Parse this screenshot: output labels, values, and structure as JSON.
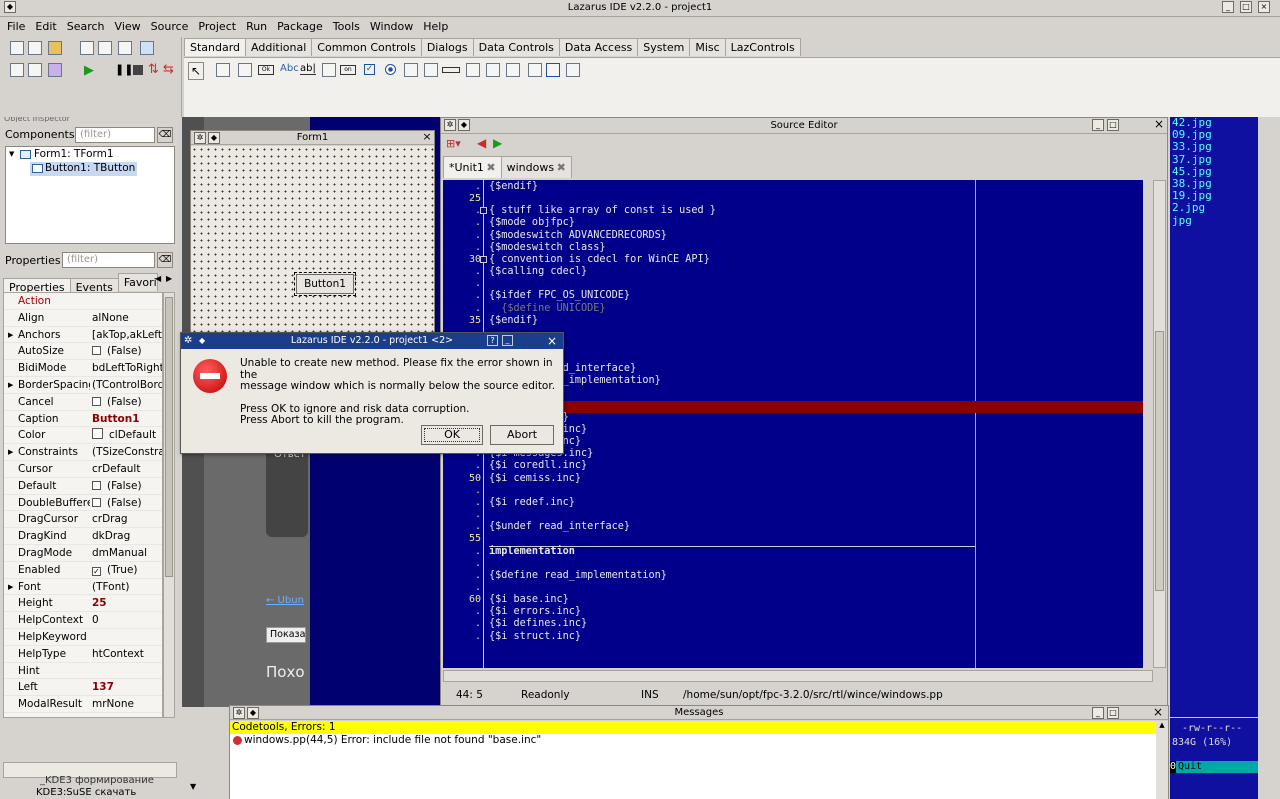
{
  "app": {
    "title": "Lazarus IDE v2.2.0 - project1"
  },
  "menu": [
    "File",
    "Edit",
    "Search",
    "View",
    "Source",
    "Project",
    "Run",
    "Package",
    "Tools",
    "Window",
    "Help"
  ],
  "palette_tabs": [
    "Standard",
    "Additional",
    "Common Controls",
    "Dialogs",
    "Data Controls",
    "Data Access",
    "System",
    "Misc",
    "LazControls"
  ],
  "palette_active": "Standard",
  "components": {
    "label": "Components",
    "filter_placeholder": "(filter)",
    "tree": [
      "Form1: TForm1",
      "Button1: TButton"
    ],
    "clipped_title": "Object Inspector"
  },
  "properties": {
    "label": "Properties",
    "filter_placeholder": "(filter)",
    "tabs": [
      "Properties",
      "Events",
      "Favorite"
    ],
    "rows": [
      {
        "name": "Action",
        "value": "",
        "red": true
      },
      {
        "name": "Align",
        "value": "alNone"
      },
      {
        "name": "Anchors",
        "value": "[akTop,akLeft]",
        "exp": true
      },
      {
        "name": "AutoSize",
        "value": "(False)",
        "cb": "unchecked"
      },
      {
        "name": "BidiMode",
        "value": "bdLeftToRight"
      },
      {
        "name": "BorderSpacing",
        "value": "(TControlBorde",
        "exp": true
      },
      {
        "name": "Cancel",
        "value": "(False)",
        "cb": "unchecked"
      },
      {
        "name": "Caption",
        "value": "Button1",
        "bold": true
      },
      {
        "name": "Color",
        "value": "clDefault",
        "swatch": true
      },
      {
        "name": "Constraints",
        "value": "(TSizeConstra",
        "exp": true
      },
      {
        "name": "Cursor",
        "value": "crDefault"
      },
      {
        "name": "Default",
        "value": "(False)",
        "cb": "unchecked"
      },
      {
        "name": "DoubleBuffered",
        "value": "(False)",
        "cb": "unchecked"
      },
      {
        "name": "DragCursor",
        "value": "crDrag"
      },
      {
        "name": "DragKind",
        "value": "dkDrag"
      },
      {
        "name": "DragMode",
        "value": "dmManual"
      },
      {
        "name": "Enabled",
        "value": "(True)",
        "cb": "checked"
      },
      {
        "name": "Font",
        "value": "(TFont)",
        "exp": true
      },
      {
        "name": "Height",
        "value": "25",
        "bold": true
      },
      {
        "name": "HelpContext",
        "value": "0"
      },
      {
        "name": "HelpKeyword",
        "value": ""
      },
      {
        "name": "HelpType",
        "value": "htContext"
      },
      {
        "name": "Hint",
        "value": ""
      },
      {
        "name": "Left",
        "value": "137",
        "bold": true
      },
      {
        "name": "ModalResult",
        "value": "mrNone"
      }
    ]
  },
  "form1": {
    "title": "Form1",
    "button": "Button1"
  },
  "background_page": {
    "link": "← Ubun",
    "button": "Показа",
    "heading": "Похо",
    "text": "Ответ"
  },
  "source_editor": {
    "title": "Source Editor",
    "tabs": [
      "*Unit1",
      "windows"
    ],
    "lines": [
      {
        "g": ".",
        "t": "{$endif}"
      },
      {
        "g": "25",
        "t": ""
      },
      {
        "g": ".",
        "t": "{ stuff like array of const is used }",
        "fold": true
      },
      {
        "g": ".",
        "t": "{$mode objfpc}"
      },
      {
        "g": ".",
        "t": "{$modeswitch ADVANCEDRECORDS}"
      },
      {
        "g": ".",
        "t": "{$modeswitch class}"
      },
      {
        "g": "30",
        "t": "{ convention is cdecl for WinCE API}",
        "fold": true
      },
      {
        "g": ".",
        "t": "{$calling cdecl}"
      },
      {
        "g": ".",
        "t": ""
      },
      {
        "g": ".",
        "t": "{$ifdef FPC_OS_UNICODE}"
      },
      {
        "g": ".",
        "t": "  {$define UNICODE}",
        "dim": true
      },
      {
        "g": "35",
        "t": "{$endif}"
      },
      {
        "g": ".",
        "t": ""
      },
      {
        "g": ".",
        "t": ""
      },
      {
        "g": ".",
        "t": ""
      },
      {
        "g": ".",
        "t": "{$define read_interface}"
      },
      {
        "g": ".",
        "t": "{$undef read_implementation}"
      },
      {
        "g": ".",
        "t": ""
      },
      {
        "g": ".",
        "t": "",
        "hl": true
      },
      {
        "g": ".",
        "t": "{$i base.inc}"
      },
      {
        "g": ".",
        "t": "{$i defines.inc}"
      },
      {
        "g": ".",
        "t": "{$i struct.inc}"
      },
      {
        "g": ".",
        "t": "{$i messages.inc}"
      },
      {
        "g": ".",
        "t": "{$i coredll.inc}"
      },
      {
        "g": "50",
        "t": "{$i cemiss.inc}"
      },
      {
        "g": ".",
        "t": ""
      },
      {
        "g": ".",
        "t": "{$i redef.inc}"
      },
      {
        "g": ".",
        "t": ""
      },
      {
        "g": ".",
        "t": "{$undef read_interface}"
      },
      {
        "g": "55",
        "t": ""
      },
      {
        "g": ".",
        "t": "implementation",
        "bold": true,
        "sep": true
      },
      {
        "g": ".",
        "t": ""
      },
      {
        "g": ".",
        "t": "{$define read_implementation}"
      },
      {
        "g": ".",
        "t": ""
      },
      {
        "g": "60",
        "t": "{$i base.inc}"
      },
      {
        "g": ".",
        "t": "{$i errors.inc}"
      },
      {
        "g": ".",
        "t": "{$i defines.inc}"
      },
      {
        "g": ".",
        "t": "{$i struct.inc}"
      }
    ],
    "status": {
      "pos": "44:  5",
      "mode": "Readonly",
      "ins": "INS",
      "path": "/home/sun/opt/fpc-3.2.0/src/rtl/wince/windows.pp"
    }
  },
  "dialog": {
    "title": "Lazarus IDE v2.2.0 - project1 <2>",
    "line1": "Unable to create new method. Please fix the error shown in the",
    "line2": "message window which is normally below the source editor.",
    "line3": "Press OK to ignore and risk data corruption.",
    "line4": "Press Abort to kill the program.",
    "ok": "OK",
    "abort": "Abort"
  },
  "messages": {
    "title": "Messages",
    "header": "Codetools, Errors: 1",
    "error": "windows.pp(44,5) Error: include file not found \"base.inc\""
  },
  "terminal": {
    "files": [
      "42.jpg",
      "09.jpg",
      "33.jpg",
      "37.jpg",
      "45.jpg",
      "38.jpg",
      "19.jpg",
      "2.jpg",
      "jpg"
    ],
    "perm": "-rw-r--r--",
    "size": "834G (16%)",
    "num": "0",
    "quit": "Quit",
    "bracket": "[^]"
  },
  "bottom_tree": [
    "KDE3:SuSE скачать"
  ],
  "colors": {
    "editor_bg": "#00008b",
    "highlight": "#8b0000",
    "msg_header": "#ffff00",
    "term_bg": "#1010a0",
    "term_fg": "#55ffff",
    "cyan": "#00a8a8"
  }
}
